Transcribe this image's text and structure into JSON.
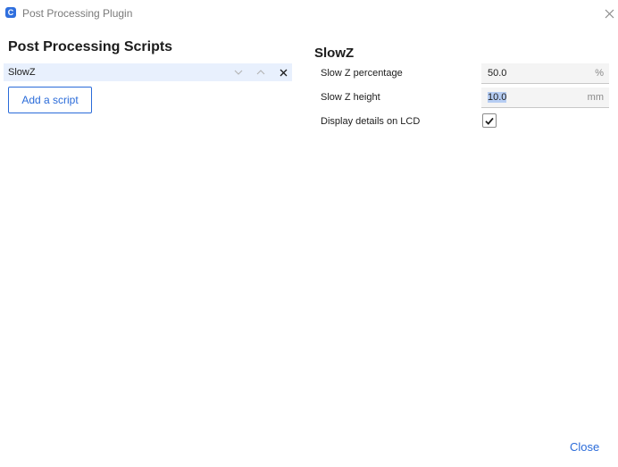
{
  "window": {
    "title": "Post Processing Plugin",
    "app_icon_glyph": "C",
    "app_icon": "cura-app-icon",
    "close_icon": "close-icon"
  },
  "scripts_panel": {
    "title": "Post Processing Scripts",
    "scripts": [
      {
        "name": "SlowZ",
        "selected": true,
        "actions": [
          "move-down-icon",
          "move-up-icon",
          "remove-icon"
        ]
      }
    ],
    "add_label": "Add a script"
  },
  "settings_panel": {
    "title": "SlowZ",
    "settings": [
      {
        "label": "Slow Z percentage",
        "value": "50.0",
        "unit": "%"
      },
      {
        "label": "Slow Z height",
        "value": "10.0",
        "unit": "mm",
        "text_selected": true
      },
      {
        "label": "Display details on LCD",
        "type": "checkbox",
        "checked": true
      }
    ]
  },
  "footer": {
    "close_label": "Close"
  },
  "colors": {
    "accent": "#2a6bd9",
    "selection_row": "#e8f0fd",
    "field_background": "#f4f4f4",
    "text": "#1c1c1c",
    "muted": "#7a7a7a"
  }
}
